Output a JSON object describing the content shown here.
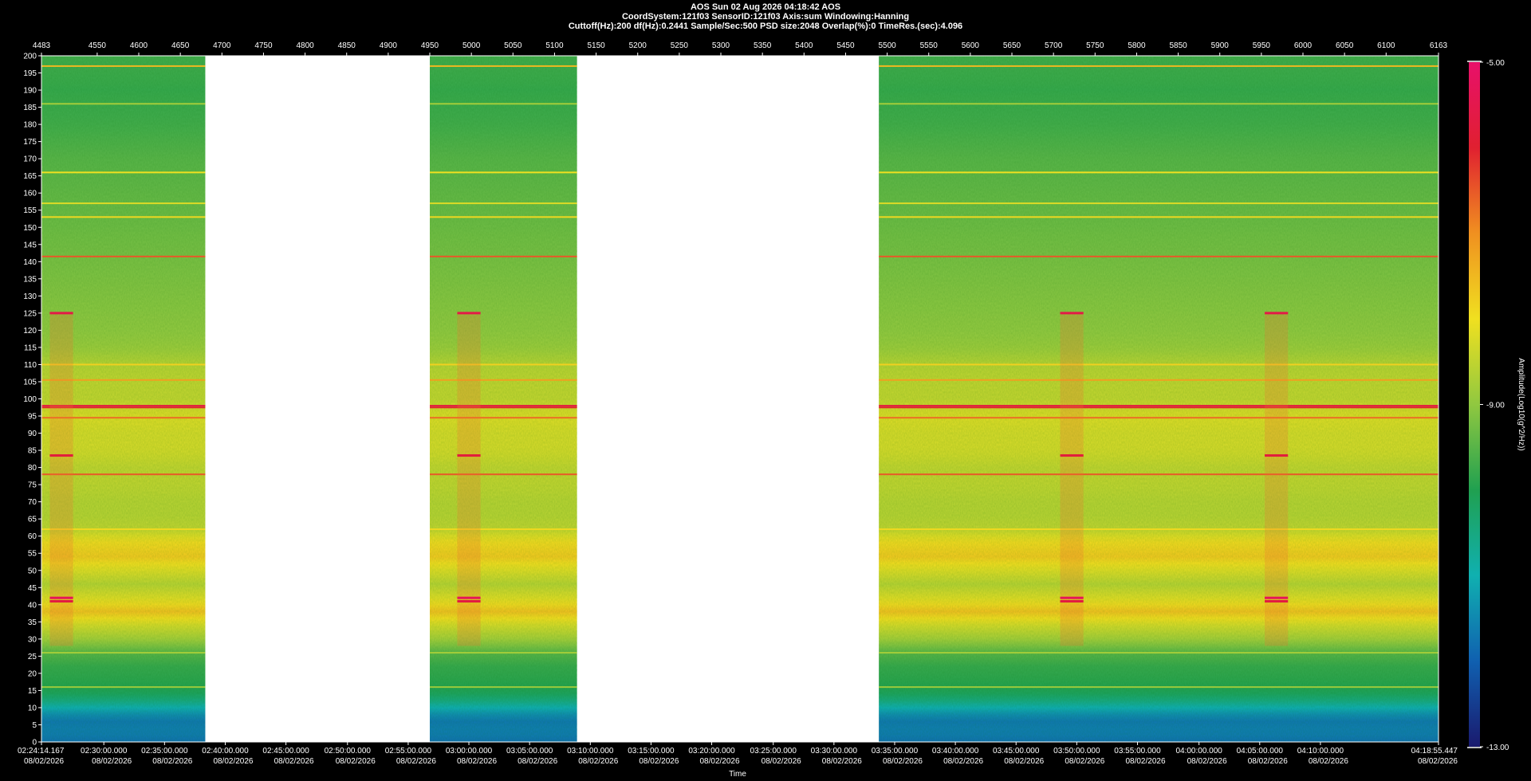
{
  "header": {
    "title": "AOS  Sun 02 Aug 2026 04:18:42  AOS",
    "line2": "CoordSystem:121f03   SensorID:121f03   Axis:sum    Windowing:Hanning",
    "line3": "Cuttoff(Hz):200      df(Hz):0.2441      Sample/Sec:500      PSD size:2048      Overlap(%):0      TimeRes.(sec):4.096"
  },
  "chart_data": {
    "type": "heatmap",
    "top_axis": {
      "range": [
        4483,
        6163
      ],
      "tick_labels": [
        "4483",
        "4550",
        "4600",
        "4650",
        "4700",
        "4750",
        "4800",
        "4850",
        "4900",
        "4950",
        "5000",
        "5050",
        "5100",
        "5150",
        "5200",
        "5250",
        "5300",
        "5350",
        "5400",
        "5450",
        "5500",
        "5550",
        "5600",
        "5650",
        "5700",
        "5750",
        "5800",
        "5850",
        "5900",
        "5950",
        "6000",
        "6050",
        "6100",
        "6163"
      ],
      "tick_values": [
        4483,
        4550,
        4600,
        4650,
        4700,
        4750,
        4800,
        4850,
        4900,
        4950,
        5000,
        5050,
        5100,
        5150,
        5200,
        5250,
        5300,
        5350,
        5400,
        5450,
        5500,
        5550,
        5600,
        5650,
        5700,
        5750,
        5800,
        5850,
        5900,
        5950,
        6000,
        6050,
        6100,
        6163
      ]
    },
    "y_axis": {
      "range": [
        0,
        200
      ],
      "tick_labels": [
        "0",
        "5",
        "10",
        "15",
        "20",
        "25",
        "30",
        "35",
        "40",
        "45",
        "50",
        "55",
        "60",
        "65",
        "70",
        "75",
        "80",
        "85",
        "90",
        "95",
        "100",
        "105",
        "110",
        "115",
        "120",
        "125",
        "130",
        "135",
        "140",
        "145",
        "150",
        "155",
        "160",
        "165",
        "170",
        "175",
        "180",
        "185",
        "190",
        "195",
        "200"
      ]
    },
    "x_axis": {
      "label": "Time",
      "tick_times": [
        "02:24:14.167",
        "02:30:00.000",
        "02:35:00.000",
        "02:40:00.000",
        "02:45:00.000",
        "02:50:00.000",
        "02:55:00.000",
        "03:00:00.000",
        "03:05:00.000",
        "03:10:00.000",
        "03:15:00.000",
        "03:20:00.000",
        "03:25:00.000",
        "03:30:00.000",
        "03:35:00.000",
        "03:40:00.000",
        "03:45:00.000",
        "03:50:00.000",
        "03:55:00.000",
        "04:00:00.000",
        "04:05:00.000",
        "04:10:00.000",
        "04:18:55.447"
      ],
      "tick_dates": [
        "08/02/2026",
        "08/02/2026",
        "08/02/2026",
        "08/02/2026",
        "08/02/2026",
        "08/02/2026",
        "08/02/2026",
        "08/02/2026",
        "08/02/2026",
        "08/02/2026",
        "08/02/2026",
        "08/02/2026",
        "08/02/2026",
        "08/02/2026",
        "08/02/2026",
        "08/02/2026",
        "08/02/2026",
        "08/02/2026",
        "08/02/2026",
        "08/02/2026",
        "08/02/2026",
        "08/02/2026",
        "08/02/2026"
      ],
      "tick_positions": [
        4483,
        4558,
        4631,
        4704,
        4777,
        4851,
        4924,
        4997,
        5070,
        5143,
        5216,
        5289,
        5363,
        5436,
        5509,
        5582,
        5655,
        5728,
        5801,
        5875,
        5948,
        6021,
        6163
      ]
    },
    "colorbar": {
      "label": "Amplitude(Log10(g^2/Hz))",
      "tick_labels": [
        "-5.00",
        "-9.00",
        "-13.00"
      ],
      "tick_values": [
        -5,
        -9,
        -13
      ],
      "range": [
        -13,
        -5
      ],
      "colors": [
        "#1a1a6e",
        "#1060b0",
        "#10b0b0",
        "#20a050",
        "#90c840",
        "#f0e020",
        "#f09020",
        "#e02030",
        "#e8106a"
      ]
    },
    "data_segments": [
      {
        "start": 4483,
        "end": 4680
      },
      {
        "start": 4950,
        "end": 5127
      },
      {
        "start": 5490,
        "end": 6163
      }
    ],
    "band_profile": [
      {
        "f": 0,
        "amp": -11.8
      },
      {
        "f": 3,
        "amp": -11.6
      },
      {
        "f": 6,
        "amp": -11.7
      },
      {
        "f": 9,
        "amp": -11.3
      },
      {
        "f": 12,
        "amp": -10.5
      },
      {
        "f": 15,
        "amp": -10.0
      },
      {
        "f": 18,
        "amp": -9.9
      },
      {
        "f": 22,
        "amp": -9.8
      },
      {
        "f": 26,
        "amp": -9.5
      },
      {
        "f": 30,
        "amp": -8.8
      },
      {
        "f": 34,
        "amp": -8.3
      },
      {
        "f": 38,
        "amp": -7.6
      },
      {
        "f": 42,
        "amp": -8.2
      },
      {
        "f": 46,
        "amp": -8.6
      },
      {
        "f": 50,
        "amp": -8.2
      },
      {
        "f": 54,
        "amp": -7.7
      },
      {
        "f": 58,
        "amp": -7.9
      },
      {
        "f": 62,
        "amp": -8.5
      },
      {
        "f": 66,
        "amp": -8.6
      },
      {
        "f": 70,
        "amp": -8.6
      },
      {
        "f": 75,
        "amp": -8.5
      },
      {
        "f": 80,
        "amp": -8.5
      },
      {
        "f": 85,
        "amp": -8.3
      },
      {
        "f": 90,
        "amp": -8.3
      },
      {
        "f": 95,
        "amp": -8.2
      },
      {
        "f": 100,
        "amp": -8.5
      },
      {
        "f": 105,
        "amp": -8.5
      },
      {
        "f": 110,
        "amp": -8.6
      },
      {
        "f": 115,
        "amp": -8.9
      },
      {
        "f": 120,
        "amp": -9.0
      },
      {
        "f": 130,
        "amp": -9.1
      },
      {
        "f": 140,
        "amp": -9.2
      },
      {
        "f": 150,
        "amp": -9.3
      },
      {
        "f": 160,
        "amp": -9.4
      },
      {
        "f": 170,
        "amp": -9.5
      },
      {
        "f": 180,
        "amp": -9.7
      },
      {
        "f": 190,
        "amp": -9.8
      },
      {
        "f": 200,
        "amp": -9.7
      }
    ],
    "tonal_lines": [
      {
        "f": 197,
        "amp": -7.5
      },
      {
        "f": 186,
        "amp": -8.8
      },
      {
        "f": 166,
        "amp": -8.0
      },
      {
        "f": 157,
        "amp": -8.2
      },
      {
        "f": 153,
        "amp": -7.9
      },
      {
        "f": 141.5,
        "amp": -6.5
      },
      {
        "f": 110,
        "amp": -7.8
      },
      {
        "f": 105.5,
        "amp": -7.2
      },
      {
        "f": 98,
        "amp": -5.7
      },
      {
        "f": 97.5,
        "amp": -6.0
      },
      {
        "f": 94.5,
        "amp": -6.7
      },
      {
        "f": 78,
        "amp": -6.5
      },
      {
        "f": 62,
        "amp": -7.9
      },
      {
        "f": 26,
        "amp": -8.8
      },
      {
        "f": 16,
        "amp": -8.9
      }
    ],
    "events": [
      {
        "t": 4493,
        "width": 28
      },
      {
        "t": 4983,
        "width": 28
      },
      {
        "t": 5708,
        "width": 28
      },
      {
        "t": 5954,
        "width": 28
      }
    ],
    "event_lines": [
      {
        "f": 125,
        "amp": -5.6
      },
      {
        "f": 83.5,
        "amp": -5.8
      },
      {
        "f": 42,
        "amp": -5.3
      },
      {
        "f": 41,
        "amp": -5.7
      }
    ]
  }
}
